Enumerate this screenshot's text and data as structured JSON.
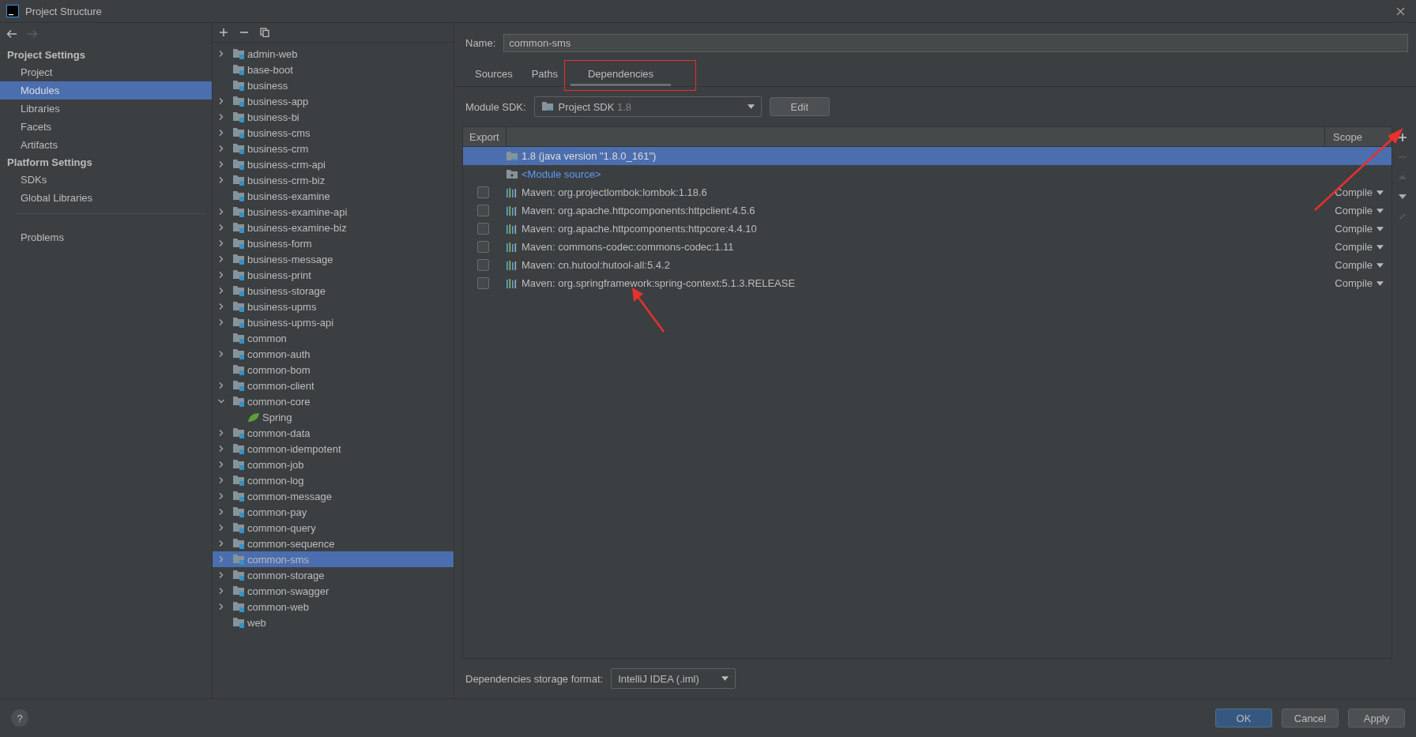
{
  "window": {
    "title": "Project Structure"
  },
  "sidebar": {
    "sections": [
      {
        "heading": "Project Settings",
        "items": [
          {
            "label": "Project",
            "selected": false
          },
          {
            "label": "Modules",
            "selected": true
          },
          {
            "label": "Libraries",
            "selected": false
          },
          {
            "label": "Facets",
            "selected": false
          },
          {
            "label": "Artifacts",
            "selected": false
          }
        ]
      },
      {
        "heading": "Platform Settings",
        "items": [
          {
            "label": "SDKs",
            "selected": false
          },
          {
            "label": "Global Libraries",
            "selected": false
          }
        ]
      },
      {
        "items": [
          {
            "label": "Problems",
            "selected": false
          }
        ]
      }
    ]
  },
  "modules": [
    {
      "label": "admin-web",
      "kind": "expandable",
      "expanded": false,
      "selected": false
    },
    {
      "label": "base-boot",
      "kind": "plain",
      "selected": false
    },
    {
      "label": "business",
      "kind": "plain",
      "selected": false
    },
    {
      "label": "business-app",
      "kind": "expandable",
      "expanded": false,
      "selected": false
    },
    {
      "label": "business-bi",
      "kind": "expandable",
      "expanded": false,
      "selected": false
    },
    {
      "label": "business-cms",
      "kind": "expandable",
      "expanded": false,
      "selected": false
    },
    {
      "label": "business-crm",
      "kind": "expandable",
      "expanded": false,
      "selected": false
    },
    {
      "label": "business-crm-api",
      "kind": "expandable",
      "expanded": false,
      "selected": false
    },
    {
      "label": "business-crm-biz",
      "kind": "expandable",
      "expanded": false,
      "selected": false
    },
    {
      "label": "business-examine",
      "kind": "plain",
      "selected": false
    },
    {
      "label": "business-examine-api",
      "kind": "expandable",
      "expanded": false,
      "selected": false
    },
    {
      "label": "business-examine-biz",
      "kind": "expandable",
      "expanded": false,
      "selected": false
    },
    {
      "label": "business-form",
      "kind": "expandable",
      "expanded": false,
      "selected": false
    },
    {
      "label": "business-message",
      "kind": "expandable",
      "expanded": false,
      "selected": false
    },
    {
      "label": "business-print",
      "kind": "expandable",
      "expanded": false,
      "selected": false
    },
    {
      "label": "business-storage",
      "kind": "expandable",
      "expanded": false,
      "selected": false
    },
    {
      "label": "business-upms",
      "kind": "expandable",
      "expanded": false,
      "selected": false
    },
    {
      "label": "business-upms-api",
      "kind": "expandable",
      "expanded": false,
      "selected": false
    },
    {
      "label": "common",
      "kind": "plain",
      "selected": false
    },
    {
      "label": "common-auth",
      "kind": "expandable",
      "expanded": false,
      "selected": false
    },
    {
      "label": "common-bom",
      "kind": "plain",
      "selected": false
    },
    {
      "label": "common-client",
      "kind": "expandable",
      "expanded": false,
      "selected": false
    },
    {
      "label": "common-core",
      "kind": "expandable",
      "expanded": true,
      "selected": false,
      "children": [
        {
          "label": "Spring",
          "selected": false
        }
      ]
    },
    {
      "label": "common-data",
      "kind": "expandable",
      "expanded": false,
      "selected": false
    },
    {
      "label": "common-idempotent",
      "kind": "expandable",
      "expanded": false,
      "selected": false
    },
    {
      "label": "common-job",
      "kind": "expandable",
      "expanded": false,
      "selected": false
    },
    {
      "label": "common-log",
      "kind": "expandable",
      "expanded": false,
      "selected": false
    },
    {
      "label": "common-message",
      "kind": "expandable",
      "expanded": false,
      "selected": false
    },
    {
      "label": "common-pay",
      "kind": "expandable",
      "expanded": false,
      "selected": false
    },
    {
      "label": "common-query",
      "kind": "expandable",
      "expanded": false,
      "selected": false
    },
    {
      "label": "common-sequence",
      "kind": "expandable",
      "expanded": false,
      "selected": false
    },
    {
      "label": "common-sms",
      "kind": "expandable",
      "expanded": false,
      "selected": true
    },
    {
      "label": "common-storage",
      "kind": "expandable",
      "expanded": false,
      "selected": false
    },
    {
      "label": "common-swagger",
      "kind": "expandable",
      "expanded": false,
      "selected": false
    },
    {
      "label": "common-web",
      "kind": "expandable",
      "expanded": false,
      "selected": false
    },
    {
      "label": "web",
      "kind": "plain",
      "selected": false
    }
  ],
  "name_field": {
    "label": "Name:",
    "value": "common-sms"
  },
  "tabs": [
    {
      "label": "Sources",
      "selected": false
    },
    {
      "label": "Paths",
      "selected": false
    },
    {
      "label": "Dependencies",
      "selected": true
    }
  ],
  "module_sdk": {
    "label": "Module SDK:",
    "value": "Project SDK",
    "version": "1.8",
    "edit_button": "Edit"
  },
  "dependencies": {
    "columns": [
      "Export",
      "Scope"
    ],
    "rows": [
      {
        "kind": "sdk",
        "label": "1.8 (java version \"1.8.0_161\")",
        "selected": true
      },
      {
        "kind": "source",
        "label": "<Module source>",
        "selected": false
      },
      {
        "kind": "library",
        "label": "Maven: org.projectlombok:lombok:1.18.6",
        "checked": false,
        "scope": "Compile",
        "selected": false
      },
      {
        "kind": "library",
        "label": "Maven: org.apache.httpcomponents:httpclient:4.5.6",
        "checked": false,
        "scope": "Compile",
        "selected": false
      },
      {
        "kind": "library",
        "label": "Maven: org.apache.httpcomponents:httpcore:4.4.10",
        "checked": false,
        "scope": "Compile",
        "selected": false
      },
      {
        "kind": "library",
        "label": "Maven: commons-codec:commons-codec:1.11",
        "checked": false,
        "scope": "Compile",
        "selected": false
      },
      {
        "kind": "library",
        "label": "Maven: cn.hutool:hutool-all:5.4.2",
        "checked": false,
        "scope": "Compile",
        "selected": false
      },
      {
        "kind": "library",
        "label": "Maven: org.springframework:spring-context:5.1.3.RELEASE",
        "checked": false,
        "scope": "Compile",
        "selected": false
      }
    ]
  },
  "storage_format": {
    "label": "Dependencies storage format:",
    "value": "IntelliJ IDEA (.iml)"
  },
  "help_button": "?",
  "buttons": [
    {
      "label": "OK",
      "primary": true
    },
    {
      "label": "Cancel",
      "primary": false
    },
    {
      "label": "Apply",
      "primary": false
    }
  ]
}
